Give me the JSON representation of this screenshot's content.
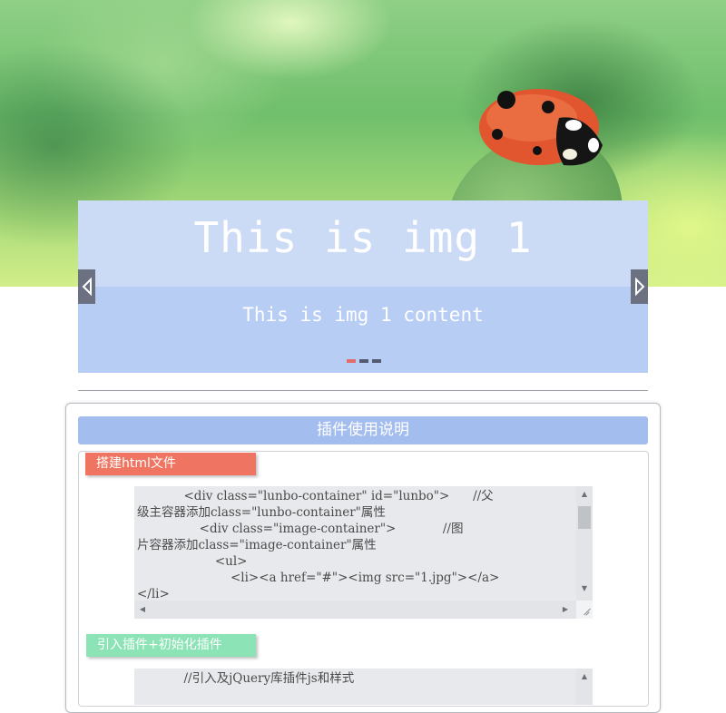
{
  "slider": {
    "title": "This is img 1",
    "content": "This is img 1 content",
    "dots": [
      {
        "active": true
      },
      {
        "active": false
      },
      {
        "active": false
      }
    ],
    "prev_icon": "triangle-left-icon",
    "next_icon": "triangle-right-icon",
    "colors": {
      "overlay": "#b8cdf3",
      "active_dot": "#e26b6b",
      "dot": "#555b6e"
    }
  },
  "instructions": {
    "heading": "插件使用说明",
    "steps": [
      {
        "label": "搭建html文件",
        "color": "#ef7462",
        "code": "            <div class=\"lunbo-container\" id=\"lunbo\">      //父\n级主容器添加class=\"lunbo-container\"属性\n                <div class=\"image-container\">            //图\n片容器添加class=\"image-container\"属性\n                    <ul>\n                        <li><a href=\"#\"><img src=\"1.jpg\"></a>\n</li>"
      },
      {
        "label": "引入插件+初始化插件",
        "color": "#8be3b6",
        "code": "            //引入及jQuery库插件js和样式"
      }
    ]
  }
}
